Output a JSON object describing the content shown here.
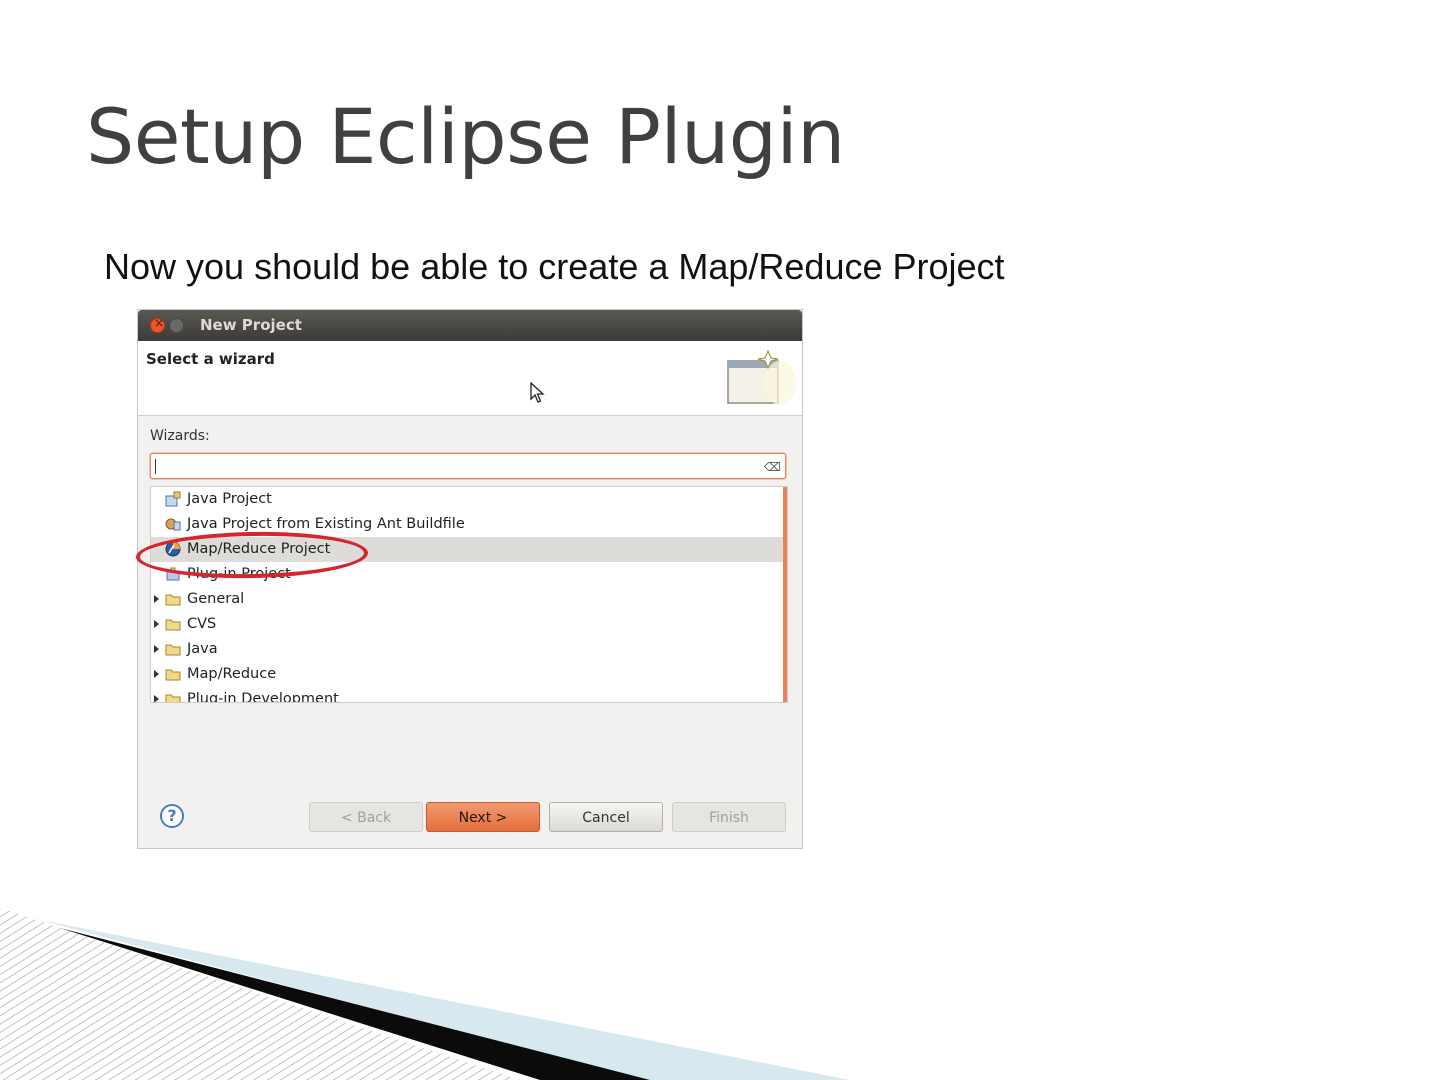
{
  "slide": {
    "title": "Setup Eclipse Plugin",
    "subtitle": "Now you should be able to create a Map/Reduce Project"
  },
  "dialog": {
    "title": "New Project",
    "header_title": "Select a wizard",
    "wizards_label": "Wizards:",
    "filter_value": "",
    "tree_items": [
      {
        "label": "Java Project",
        "icon": "java-project-icon",
        "expandable": false
      },
      {
        "label": "Java Project from Existing Ant Buildfile",
        "icon": "ant-project-icon",
        "expandable": false
      },
      {
        "label": "Map/Reduce Project",
        "icon": "mapreduce-project-icon",
        "expandable": false,
        "selected": true
      },
      {
        "label": "Plug-in Project",
        "icon": "plugin-project-icon",
        "expandable": false
      },
      {
        "label": "General",
        "icon": "folder-icon",
        "expandable": true
      },
      {
        "label": "CVS",
        "icon": "folder-icon",
        "expandable": true
      },
      {
        "label": "Java",
        "icon": "folder-icon",
        "expandable": true
      },
      {
        "label": "Map/Reduce",
        "icon": "folder-icon",
        "expandable": true
      },
      {
        "label": "Plug-in Development",
        "icon": "folder-icon",
        "expandable": true
      }
    ],
    "buttons": {
      "help": "?",
      "back": "< Back",
      "next": "Next >",
      "cancel": "Cancel",
      "finish": "Finish"
    }
  },
  "colors": {
    "accent": "#e46f3f",
    "highlight_ring": "#d4262f",
    "title_text": "#404040"
  }
}
